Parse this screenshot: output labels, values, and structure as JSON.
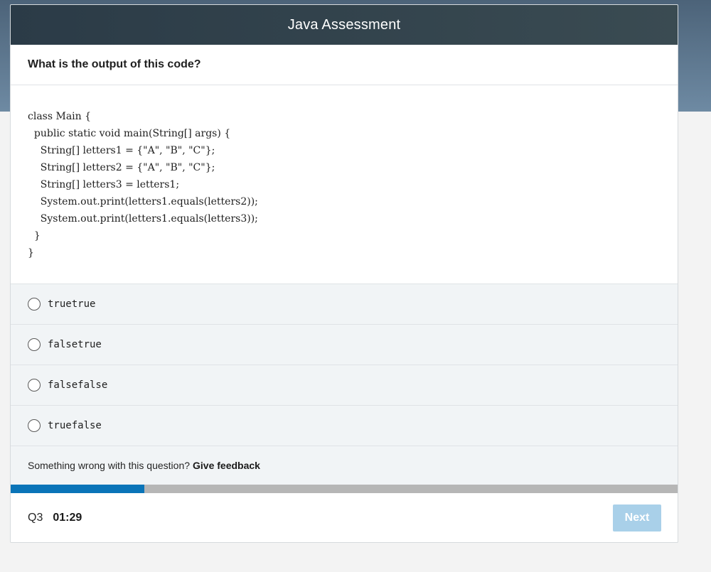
{
  "header": {
    "title": "Java Assessment"
  },
  "question": {
    "prompt": "What is the output of this code?"
  },
  "code": {
    "lines": [
      "class Main {",
      "  public static void main(String[] args) {",
      "    String[] letters1 = {\"A\", \"B\", \"C\"};",
      "    String[] letters2 = {\"A\", \"B\", \"C\"};",
      "    String[] letters3 = letters1;",
      "    System.out.print(letters1.equals(letters2));",
      "    System.out.print(letters1.equals(letters3));",
      "  }",
      "}"
    ]
  },
  "options": [
    {
      "label": "truetrue"
    },
    {
      "label": "falsetrue"
    },
    {
      "label": "falsefalse"
    },
    {
      "label": "truefalse"
    }
  ],
  "feedback": {
    "text": "Something wrong with this question?",
    "link": "Give feedback"
  },
  "progress": {
    "fraction": 0.2
  },
  "footer": {
    "question_number": "Q3",
    "timer": "01:29",
    "next_label": "Next"
  },
  "colors": {
    "header_bg": "#2b3b47",
    "progress_fill": "#0a74b8",
    "progress_track": "#b6b6b6",
    "next_button_disabled": "#a9d0e9"
  }
}
